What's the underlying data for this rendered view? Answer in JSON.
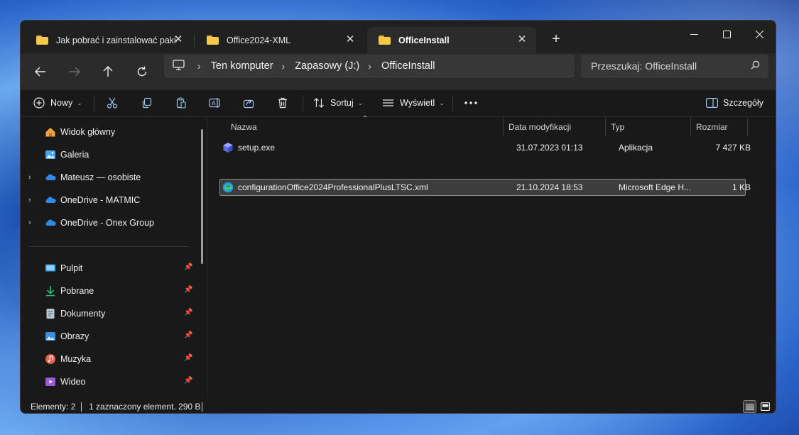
{
  "tabs": [
    {
      "label": "Jak pobrać i zainstalować pakie",
      "active": false
    },
    {
      "label": "Office2024-XML",
      "active": false
    },
    {
      "label": "OfficeInstall",
      "active": true
    }
  ],
  "new_tab_label": "+",
  "window_controls": {
    "minimize": "minimize-icon",
    "maximize": "maximize-icon",
    "close": "close-icon"
  },
  "breadcrumb": [
    "Ten komputer",
    "Zapasowy (J:)",
    "OfficeInstall"
  ],
  "search": {
    "placeholder": "Przeszukaj: OfficeInstall"
  },
  "toolbar": {
    "new_label": "Nowy",
    "sort_label": "Sortuj",
    "view_label": "Wyświetl",
    "details_label": "Szczegóły"
  },
  "sidebar": {
    "items": [
      {
        "label": "Widok główny",
        "icon": "home-icon"
      },
      {
        "label": "Galeria",
        "icon": "gallery-icon"
      },
      {
        "label": "Mateusz — osobiste",
        "icon": "onedrive-icon"
      },
      {
        "label": "OneDrive - MATMIC",
        "icon": "onedrive-icon"
      },
      {
        "label": "OneDrive - Onex Group",
        "icon": "onedrive-icon"
      }
    ],
    "pinned": [
      {
        "label": "Pulpit",
        "icon": "desktop-icon"
      },
      {
        "label": "Pobrane",
        "icon": "download-icon"
      },
      {
        "label": "Dokumenty",
        "icon": "documents-icon"
      },
      {
        "label": "Obrazy",
        "icon": "pictures-icon"
      },
      {
        "label": "Muzyka",
        "icon": "music-icon"
      },
      {
        "label": "Wideo",
        "icon": "video-icon"
      }
    ]
  },
  "columns": {
    "name": "Nazwa",
    "modified": "Data modyfikacji",
    "type": "Typ",
    "size": "Rozmiar"
  },
  "files": [
    {
      "name": "setup.exe",
      "modified": "31.07.2023 01:13",
      "type": "Aplikacja",
      "size": "7 427 KB",
      "icon": "setup-app-icon",
      "selected": false
    },
    {
      "name": "configurationOffice2024ProfessionalPlusLTSC.xml",
      "modified": "21.10.2024 18:53",
      "type": "Microsoft Edge H...",
      "size": "1 KB",
      "icon": "edge-icon",
      "selected": true
    }
  ],
  "status": {
    "count": "Elementy: 2",
    "selection": "1 zaznaczony element. 290 B"
  },
  "colors": {
    "accent": "#0078d4",
    "folder": "#f6c94a",
    "window_bg": "#191919"
  }
}
